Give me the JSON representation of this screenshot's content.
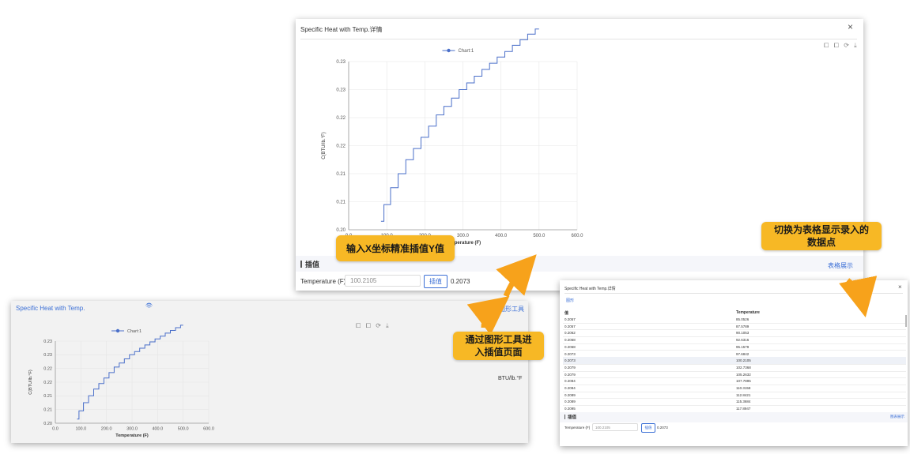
{
  "main_dialog": {
    "title": "Specific Heat with Temp.详情",
    "close_icon": "×",
    "toolbar_icons": "⧠ ⧠ ⟳ ⤓",
    "section_title": "插值",
    "table_link": "表格展示",
    "field_label": "Temperature (F)",
    "field_value": "100.2105",
    "interp_button": "插值",
    "result": "0.2073"
  },
  "left_panel": {
    "title": "Specific Heat with Temp.",
    "eye_icon": "👁",
    "graph_tool_link": "图形工具",
    "unit_label": "BTU/lb.°F",
    "toolbar_icons": "⧠ ⧠ ⟳ ⤓"
  },
  "table_dialog": {
    "title": "Specific Heat with Temp.详情",
    "close_icon": "×",
    "chart_tab": "图形",
    "col_value": "值",
    "col_temp": "Temperature",
    "rows": [
      [
        "0.2057",
        "85.0526"
      ],
      [
        "0.2057",
        "87.5789"
      ],
      [
        "0.2062",
        "90.1053"
      ],
      [
        "0.2068",
        "92.6316"
      ],
      [
        "0.2068",
        "95.1579"
      ],
      [
        "0.2073",
        "97.6842"
      ],
      [
        "0.2073",
        "100.2105"
      ],
      [
        "0.2079",
        "102.7368"
      ],
      [
        "0.2079",
        "105.2632"
      ],
      [
        "0.2084",
        "107.7895"
      ],
      [
        "0.2084",
        "110.3158"
      ],
      [
        "0.2089",
        "112.8421"
      ],
      [
        "0.2089",
        "115.3684"
      ],
      [
        "0.2095",
        "117.8947"
      ]
    ],
    "section_title": "插值",
    "table_link": "图表展示",
    "field_label": "Temperature (F)",
    "field_value": "100.2105",
    "interp_button": "插值",
    "result": "0.2073"
  },
  "callouts": {
    "input_x": "输入X坐标精准插值Y值",
    "table_switch_line1": "切换为表格显示录入的",
    "table_switch_line2": "数据点",
    "graph_tool_line1": "通过图形工具进",
    "graph_tool_line2": "入插值页面"
  },
  "chart_data": [
    {
      "type": "line",
      "series": [
        {
          "name": "Chart:1",
          "color": "#4a6fc9"
        }
      ],
      "x_ticks": [
        "0.0",
        "100.0",
        "200.0",
        "300.0",
        "400.0",
        "500.0",
        "600.0"
      ],
      "y_ticks": [
        "0.20",
        "0.21",
        "0.21",
        "0.22",
        "0.22",
        "0.23",
        "0.23"
      ],
      "xlabel": "Temperature (F)",
      "ylabel": "C(BTU/lb.°F)",
      "xlim": [
        0,
        600
      ],
      "ylim": [
        0.2,
        0.23
      ],
      "x": [
        85,
        100,
        120,
        140,
        160,
        180,
        200,
        220,
        240,
        260,
        280,
        300,
        320,
        340,
        360,
        380,
        400,
        420,
        440,
        460,
        480,
        500
      ],
      "y": [
        0.2015,
        0.2045,
        0.2075,
        0.21,
        0.2125,
        0.2145,
        0.2165,
        0.2185,
        0.2205,
        0.222,
        0.2235,
        0.225,
        0.2262,
        0.2274,
        0.2286,
        0.2297,
        0.2308,
        0.2318,
        0.2329,
        0.2339,
        0.2349,
        0.2358
      ]
    },
    {
      "type": "line",
      "series": [
        {
          "name": "Chart:1",
          "color": "#4a6fc9"
        }
      ],
      "x_ticks": [
        "0.0",
        "100.0",
        "200.0",
        "300.0",
        "400.0",
        "500.0",
        "600.0"
      ],
      "y_ticks": [
        "0.20",
        "0.21",
        "0.21",
        "0.22",
        "0.22",
        "0.23",
        "0.23"
      ],
      "xlabel": "Temperature (F)",
      "ylabel": "C(BTU/lb.°F)",
      "xlim": [
        0,
        600
      ],
      "ylim": [
        0.2,
        0.23
      ],
      "x": [
        85,
        100,
        120,
        140,
        160,
        180,
        200,
        220,
        240,
        260,
        280,
        300,
        320,
        340,
        360,
        380,
        400,
        420,
        440,
        460,
        480,
        500
      ],
      "y": [
        0.2015,
        0.2045,
        0.2075,
        0.21,
        0.2125,
        0.2145,
        0.2165,
        0.2185,
        0.2205,
        0.222,
        0.2235,
        0.225,
        0.2262,
        0.2274,
        0.2286,
        0.2297,
        0.2308,
        0.2318,
        0.2329,
        0.2339,
        0.2349,
        0.2358
      ]
    }
  ]
}
